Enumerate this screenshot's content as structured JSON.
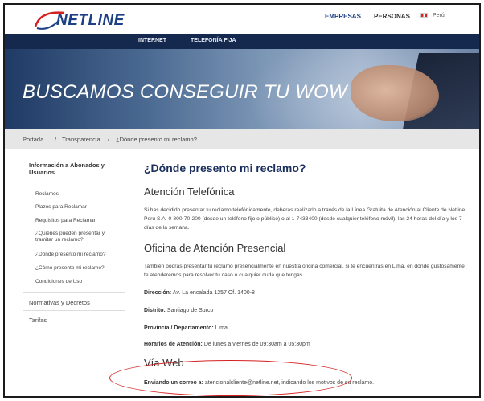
{
  "header": {
    "logo_text": "NETLINE",
    "nav": {
      "empresas": "EMPRESAS",
      "personas": "PERSONAS"
    },
    "country": "Perú"
  },
  "navbar": {
    "internet": "INTERNET",
    "telefonia": "TELEFONÍA FIJA"
  },
  "banner": {
    "title": "BUSCAMOS CONSEGUIR TU WOW"
  },
  "breadcrumb": {
    "items": [
      "Portada",
      "Transparencia",
      "¿Dónde presento mi reclamo?"
    ],
    "separator": "/"
  },
  "sidebar": {
    "section_title": "Información a Abonados y Usuarios",
    "items": [
      "Reclamos",
      "Plazos para Reclamar",
      "Requisitos para Reclamar",
      "¿Quiénes pueden presentar y tramitar un reclamo?",
      "¿Dónde presento mi reclamo?",
      "¿Cómo presento mi reclamo?",
      "Condiciones de Uso"
    ],
    "main_items": [
      "Normativas y Decretos",
      "Tarifas"
    ]
  },
  "content": {
    "title": "¿Dónde presento mi reclamo?",
    "phone": {
      "heading": "Atención Telefónica",
      "text": "Si has decidido presentar tu reclamo telefónicamente, deberás realizarlo a través de la Línea Gratuita de Atención al Cliente de Netline Perú S.A. 0-800-70-200 (desde un teléfono fijo o público) o al 1-7433400 (desde cualquier teléfono móvil), las 24 horas del día y los 7 días de la semana."
    },
    "office": {
      "heading": "Oficina de Atención Presencial",
      "text": "También podrás presentar tu reclamo presencialmente en nuestra oficina comercial, si te encuentras en Lima, en donde gustosamente te atenderemos para resolver tu caso o cualquier duda que tengas.",
      "address_label": "Dirección:",
      "address": "Av. La encalada 1257 Of. 1400-8",
      "district_label": "Distrito:",
      "district": "Santiago de Surco",
      "province_label": "Provincia / Departamento:",
      "province": "Lima",
      "hours_label": "Horarios de Atención:",
      "hours": "De lunes a viernes de 09:30am a 05:30pm"
    },
    "web": {
      "heading": "Vía Web",
      "lead": "Enviando un correo a:",
      "email": "atencionalcliente@netline.net",
      "tail": ", indicando los motivos de su reclamo."
    }
  },
  "colors": {
    "brand_navy": "#1c3f86",
    "navbar": "#15294e",
    "highlight_oval": "#d62020"
  }
}
